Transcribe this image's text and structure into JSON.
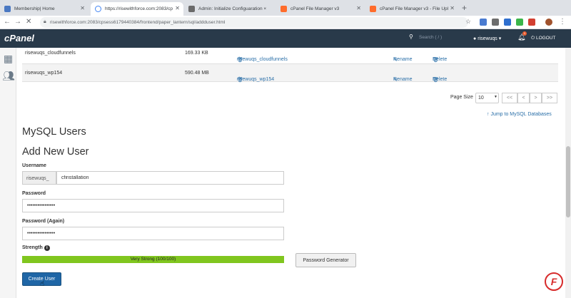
{
  "browser": {
    "tabs": [
      {
        "label": "Membership| Home",
        "color": "#4a78c2"
      },
      {
        "label": "https://risewithforce.com:2083/cp",
        "color": "#4285f4",
        "active": true
      },
      {
        "label": "Admin: Initialize Configuaration ×",
        "color": "#6a6a6a"
      },
      {
        "label": "cPanel File Manager v3",
        "color": "#ff6c2c"
      },
      {
        "label": "cPanel File Manager v3 - File Upl",
        "color": "#ff6c2c"
      }
    ],
    "url": "risewithforce.com:2083/cpsess6179440384/frontend/paper_lantern/sql/addduser.html"
  },
  "header": {
    "logo": "cPanel",
    "search_placeholder": "Search ( / )",
    "user": "risewuqs",
    "notifications": "1",
    "logout": "LOGOUT"
  },
  "databases": [
    {
      "name": "risewuqs_cloudfunnels",
      "size": "169.33 KB",
      "user": "risewuqs_cloudfunnels",
      "rename": "Rename",
      "delete": "Delete"
    },
    {
      "name": "risewuqs_wp154",
      "size": "590.48 MB",
      "user": "risewuqs_wp154",
      "rename": "Rename",
      "delete": "Delete"
    }
  ],
  "pager": {
    "label": "Page Size",
    "value": "10",
    "first": "<<",
    "prev": "<",
    "next": ">",
    "last": ">>"
  },
  "jump_link": "Jump to MySQL Databases",
  "mysql_users_title": "MySQL Users",
  "add_user_title": "Add New User",
  "form": {
    "username_label": "Username",
    "prefix": "risewuqs_",
    "username_value": "cfinstallation",
    "password_label": "Password",
    "password_value": "••••••••••••••••",
    "password_again_label": "Password (Again)",
    "password_again_value": "••••••••••••••••",
    "strength_label": "Strength",
    "strength_text": "Very Strong (100/100)",
    "strength_value": 100,
    "password_generator": "Password Generator",
    "create_button": "Create User"
  },
  "colors": {
    "header_bg": "#293a4a",
    "strength_fill": "#80c61e",
    "primary_button": "#1f66a6",
    "link": "#2a6fa8"
  }
}
